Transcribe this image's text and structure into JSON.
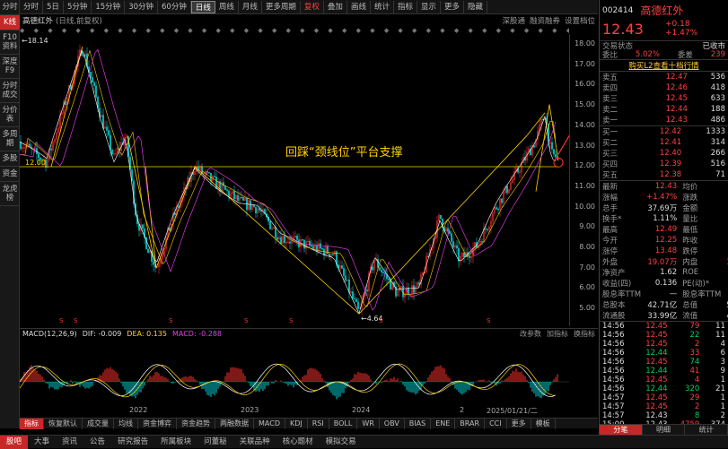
{
  "left_tabs": [
    "分时",
    "K线",
    "F10资料",
    "深度F9",
    "分时成交",
    "分价表",
    "多周期",
    "多股",
    "资金",
    "龙虎榜"
  ],
  "periods": [
    "分时",
    "5日",
    "5分钟",
    "15分钟",
    "30分钟",
    "60分钟",
    "日线",
    "周线",
    "月线",
    "更多周期",
    "复权",
    "叠加",
    "画线",
    "统计",
    "指标",
    "显示",
    "更多",
    "隐藏"
  ],
  "stock_title": "高德红外",
  "stock_sub": "(日线,前复权)",
  "sub_right": [
    "深股通",
    "融资融券",
    "设置档位"
  ],
  "dots": "◆ ◆ ◆ ◆ ◆ ◆ ◆ ◆ ◆ ◆ ◆ ◆ ◆ ◆ ◆ ◆ ◆ ◆ ◆ ◆ ◆ ◆ ◆ ◆ ◆ ◆ ◆ ◆ ◆ ◆ ◆ ◆ ◆ ◆ ◆ ◆ ◆ ◆ ◆ ◆ ◆ ◆ ◆ ◆ ◆ ◆ ◆ ◆ ◆",
  "annotation": "回踩“颈线位”平台支撑",
  "high_label": "←18.14",
  "low_label": "←4.64",
  "neck_label": "12.00",
  "last_label": "5.48",
  "y_ticks": [
    "18.00",
    "17.00",
    "16.00",
    "15.00",
    "14.00",
    "13.00",
    "12.00",
    "11.00",
    "10.00",
    "9.00",
    "8.00",
    "7.00",
    "6.00",
    "5.00"
  ],
  "x_ticks": [
    "2022",
    "2023",
    "2024",
    "2",
    "2025/01/21/二"
  ],
  "macd": {
    "title": "MACD(12,26,9)",
    "dif": "DIF: -0.009",
    "dea": "DEA: 0.135",
    "macd": "MACD: -0.288",
    "btns": [
      "改参数",
      "加指标",
      "换指标"
    ]
  },
  "ind_tabs": [
    "指标",
    "恢复默认",
    "成交量",
    "均线",
    "资金博弈",
    "资金趋势",
    "两融数据",
    "MACD",
    "KDJ",
    "RSI",
    "BOLL",
    "WR",
    "OBV",
    "BIAS",
    "ENE",
    "BRAR",
    "CCI",
    "更多",
    "模板"
  ],
  "bottom_tabs": [
    "股吧",
    "大事",
    "资讯",
    "公告",
    "研究报告",
    "所属板块",
    "问董秘",
    "关联品种",
    "核心题材",
    "模拟交易"
  ],
  "right": {
    "code": "002414",
    "name": "高德红外",
    "price": "12.43",
    "chg": "+0.18",
    "pct": "+1.47%",
    "status": [
      "交易状态",
      "已收市"
    ],
    "wb": [
      "委比",
      "5.02%",
      "委差",
      "239"
    ],
    "l2": "购买L2查看十档行情",
    "sell": [
      [
        "卖五",
        "12.47",
        "536"
      ],
      [
        "卖四",
        "12.46",
        "418"
      ],
      [
        "卖三",
        "12.45",
        "633"
      ],
      [
        "卖二",
        "12.44",
        "188"
      ],
      [
        "卖一",
        "12.43",
        "486"
      ]
    ],
    "buy": [
      [
        "买一",
        "12.42",
        "1333"
      ],
      [
        "买二",
        "12.41",
        "314"
      ],
      [
        "买三",
        "12.40",
        "266"
      ],
      [
        "买四",
        "12.39",
        "516"
      ],
      [
        "买五",
        "12.38",
        "71"
      ]
    ],
    "stats": [
      [
        "最新",
        "12.43",
        "均价",
        "12.36"
      ],
      [
        "涨幅",
        "+1.47%",
        "涨跌",
        "+0.18"
      ],
      [
        "总手",
        "37.69万",
        "金额",
        "4.66亿"
      ],
      [
        "换手*",
        "1.11%",
        "量比",
        "0.62"
      ],
      [
        "最高",
        "12.49",
        "最低",
        "12.10"
      ],
      [
        "今开",
        "12.25",
        "昨收",
        "12.25"
      ],
      [
        "涨停",
        "13.48",
        "跌停",
        "11.03"
      ],
      [
        "外盘",
        "19.07万",
        "内盘",
        "18.62万"
      ],
      [
        "净资产",
        "1.62",
        "ROE",
        "8.78%"
      ],
      [
        "收益(四)",
        "0.136",
        "PE(动)*",
        "68.42"
      ],
      [
        "股息率TTM",
        "—",
        "股息率TTM",
        "—"
      ],
      [
        "总股本",
        "42.71亿",
        "总值",
        "530.9亿"
      ],
      [
        "流通股",
        "33.99亿",
        "流值",
        "422.4亿"
      ]
    ],
    "ticks": [
      [
        "14:56",
        "12.45",
        "79",
        "11"
      ],
      [
        "14:56",
        "12.45",
        "22",
        "11"
      ],
      [
        "14:56",
        "12.45",
        "2",
        "4"
      ],
      [
        "14:56",
        "12.44",
        "33",
        "6"
      ],
      [
        "14:56",
        "12.45",
        "74",
        "3"
      ],
      [
        "14:56",
        "12.44",
        "41",
        "9"
      ],
      [
        "14:56",
        "12.45",
        "4",
        "1"
      ],
      [
        "14:56",
        "12.44",
        "320",
        "21"
      ],
      [
        "14:57",
        "12.45",
        "29",
        "1"
      ],
      [
        "14:57",
        "12.45",
        "2",
        "1"
      ],
      [
        "14:57",
        "12.43",
        "8",
        "2"
      ],
      [
        "15:00",
        "12.43",
        "4759",
        "374"
      ]
    ],
    "tabs": [
      "分笔",
      "明细",
      "统计"
    ]
  }
}
